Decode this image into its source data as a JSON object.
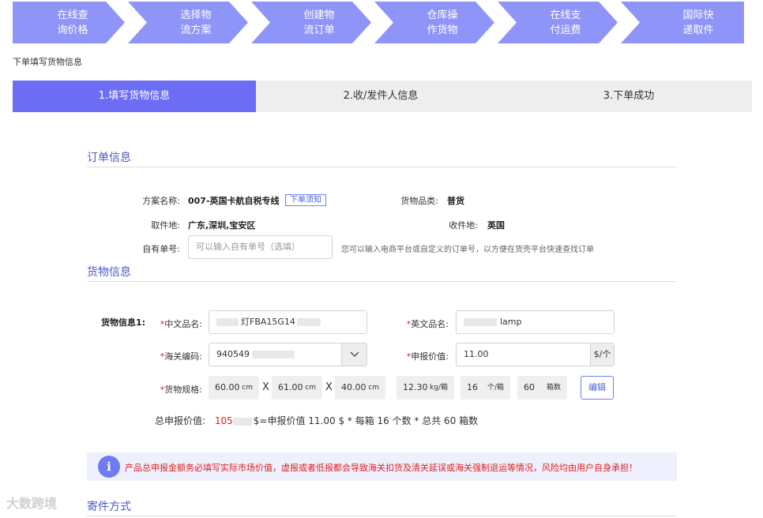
{
  "process_steps": [
    {
      "line1": "在线查",
      "line2": "询价格"
    },
    {
      "line1": "选择物",
      "line2": "流方案"
    },
    {
      "line1": "创建物",
      "line2": "流订单"
    },
    {
      "line1": "仓库操",
      "line2": "作货物"
    },
    {
      "line1": "在线支",
      "line2": "付运费"
    },
    {
      "line1": "国际快",
      "line2": "递取件"
    }
  ],
  "colors": {
    "process_bar": "#8f95f8",
    "active_tab": "#6c6cf5",
    "section_title": "#4a5bc4",
    "required": "#e02020"
  },
  "breadcrumb": "下单填写货物信息",
  "wizard": [
    "1.填写货物信息",
    "2.收/发件人信息",
    "3.下单成功"
  ],
  "order": {
    "section_title": "订单信息",
    "plan_label": "方案名称:",
    "plan_value": "007-英国卡航自税专线",
    "notice_tag": "下单须知",
    "category_label": "货物品类:",
    "category_value": "普货",
    "pickup_label": "取件地:",
    "pickup_value": "广东,深圳,宝安区",
    "dest_label": "收件地:",
    "dest_value": "英国",
    "own_no_label": "自有单号:",
    "own_no_placeholder": "可以输入自有单号（选填）",
    "own_no_hint": "您可以输入电商平台或自定义的订单号，以方便在货壳平台快速查找订单"
  },
  "goods": {
    "section_title": "货物信息",
    "item_label": "货物信息1:",
    "cn_name_label": "中文品名:",
    "cn_name_value": "灯FBA15G14",
    "en_name_label": "英文品名:",
    "en_name_value": "lamp",
    "hs_label": "海关编码:",
    "hs_value": "940549",
    "declared_label": "申报价值:",
    "declared_value": "11.00",
    "declared_unit": "$/个",
    "spec_label": "货物规格:",
    "length": "60.00",
    "width": "61.00",
    "height": "40.00",
    "dim_unit": "cm",
    "x_sign": "X",
    "weight": "12.30",
    "weight_unit": "kg/箱",
    "per_box": "16",
    "per_box_unit": "个/箱",
    "boxes": "60",
    "boxes_unit": "箱数",
    "edit_button": "编辑",
    "total_label": "总申报价值:",
    "total_value": "105",
    "total_formula": "$=申报价值 11.00 $  *  每箱 16 个数  *  总共 60 箱数"
  },
  "notice": {
    "icon": "i",
    "text": "产品总申报金额务必填写实际市场价值，虚报或者低报都会导致海关扣货及清关延误或海关强制退运等情况，风险均由用户自身承担！"
  },
  "next_section_title": "寄件方式",
  "watermark": "大数跨境"
}
